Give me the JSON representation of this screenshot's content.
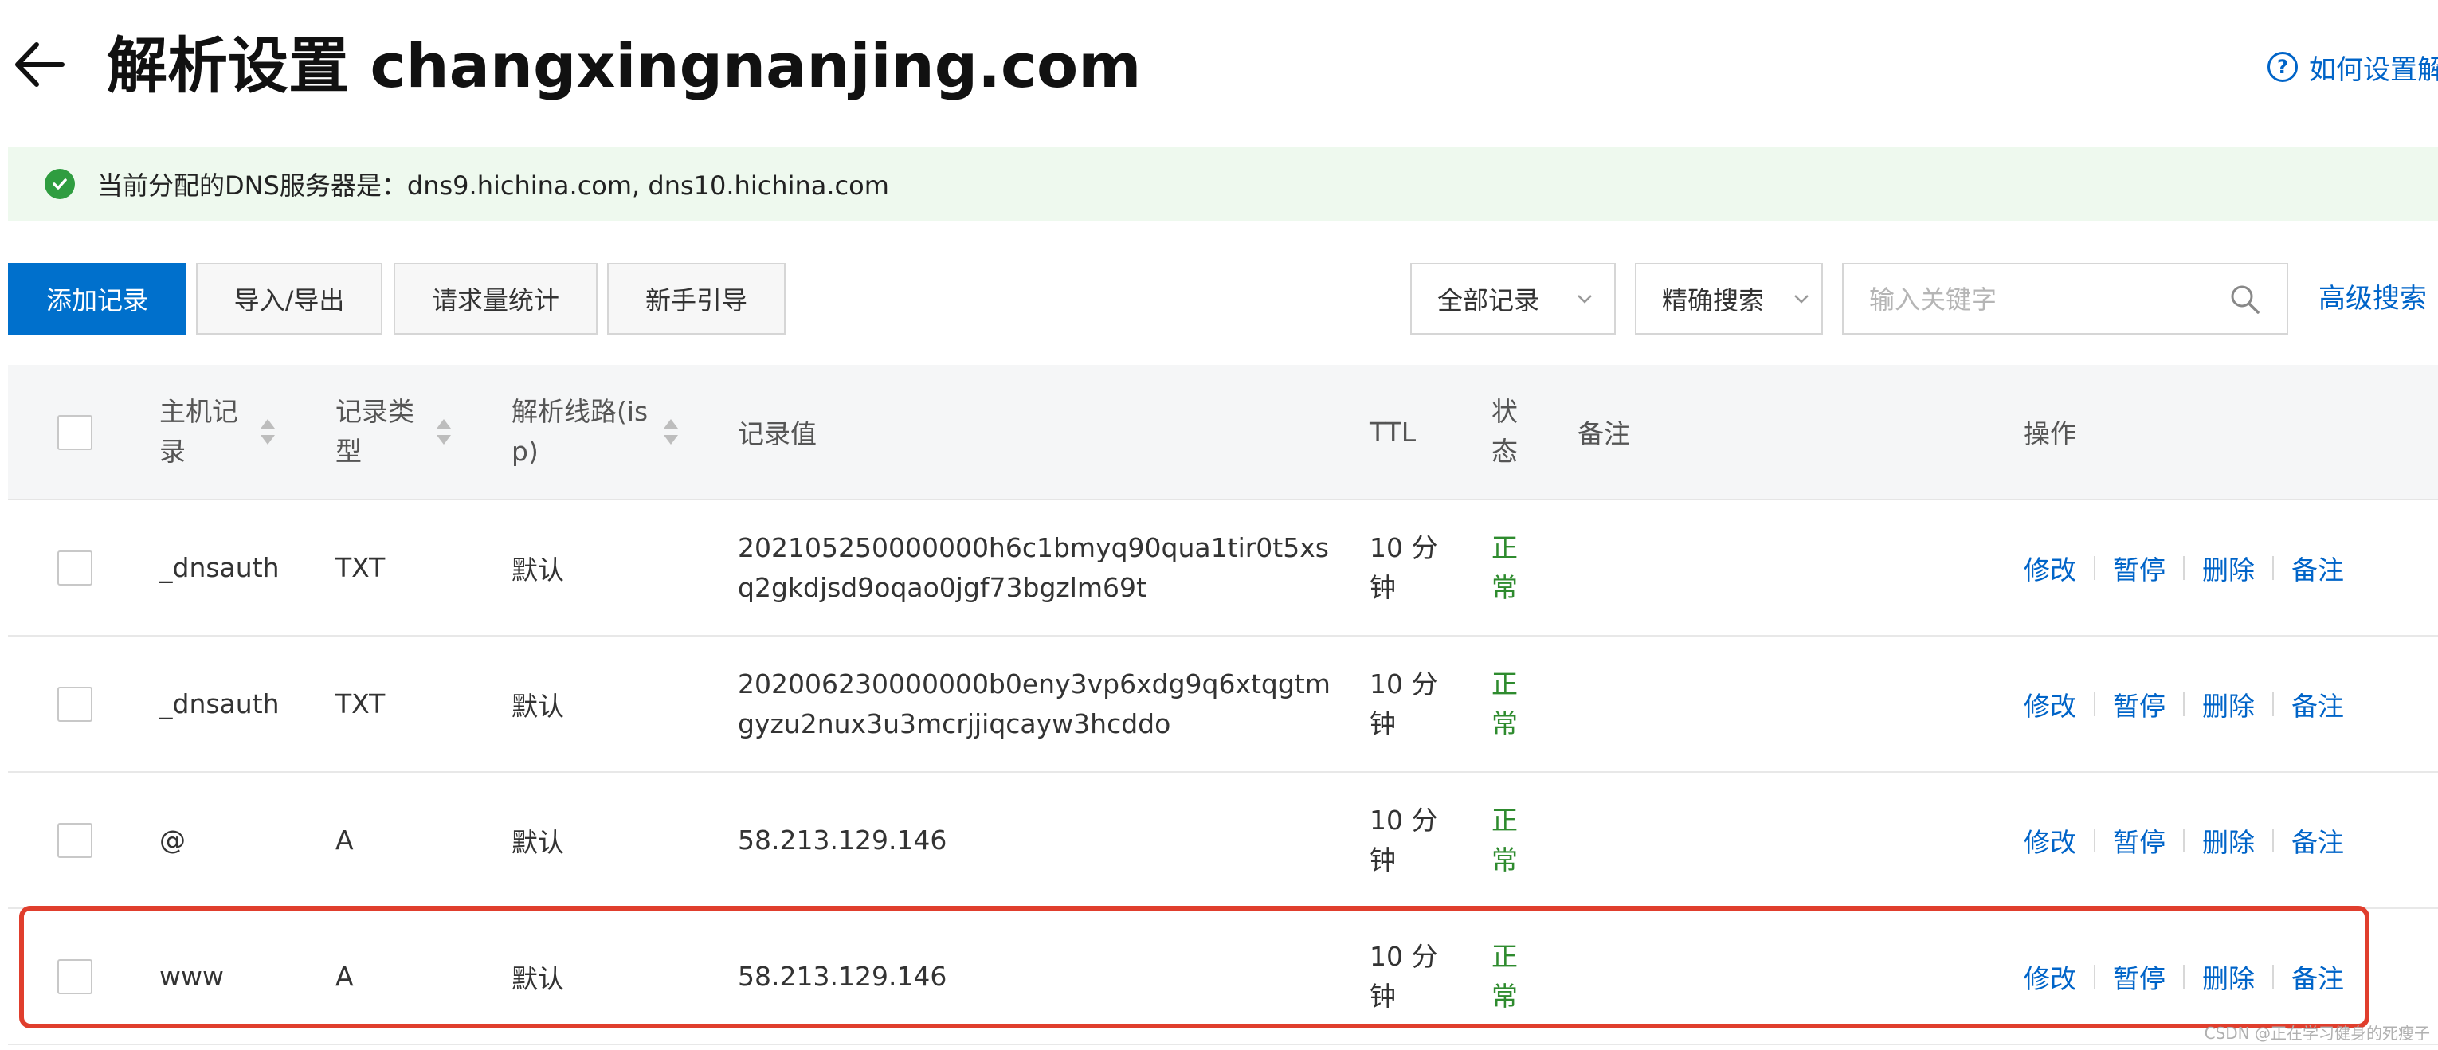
{
  "header": {
    "title": "解析设置 changxingnanjing.com",
    "help_link": "如何设置解"
  },
  "notice": {
    "text": "当前分配的DNS服务器是：dns9.hichina.com, dns10.hichina.com"
  },
  "toolbar": {
    "add_record": "添加记录",
    "import_export": "导入/导出",
    "request_stats": "请求量统计",
    "beginner_guide": "新手引导",
    "record_filter": "全部记录",
    "search_mode": "精确搜索",
    "search_placeholder": "输入关键字",
    "advanced_search": "高级搜索"
  },
  "table": {
    "headers": {
      "host": [
        "主机记",
        "录"
      ],
      "type": [
        "记录类",
        "型"
      ],
      "line": [
        "解析线路(is",
        "p)"
      ],
      "value": "记录值",
      "ttl": "TTL",
      "status": [
        "状",
        "态"
      ],
      "remark": "备注",
      "actions": "操作"
    },
    "action_labels": [
      "修改",
      "暂停",
      "删除",
      "备注"
    ],
    "rows": [
      {
        "host": "_dnsauth",
        "type": "TXT",
        "line": "默认",
        "value": [
          "202105250000000h6c1bmyq90qua1tir0t5xs",
          "q2gkdjsd9oqao0jgf73bgzlm69t"
        ],
        "ttl": [
          "10 分",
          "钟"
        ],
        "status": [
          "正",
          "常"
        ]
      },
      {
        "host": "_dnsauth",
        "type": "TXT",
        "line": "默认",
        "value": [
          "202006230000000b0eny3vp6xdg9q6xtqgtm",
          "gyzu2nux3u3mcrjjiqcayw3hcddo"
        ],
        "ttl": [
          "10 分",
          "钟"
        ],
        "status": [
          "正",
          "常"
        ]
      },
      {
        "host": "@",
        "type": "A",
        "line": "默认",
        "value": [
          "58.213.129.146"
        ],
        "ttl": [
          "10 分",
          "钟"
        ],
        "status": [
          "正",
          "常"
        ]
      },
      {
        "host": "www",
        "type": "A",
        "line": "默认",
        "value": [
          "58.213.129.146"
        ],
        "ttl": [
          "10 分",
          "钟"
        ],
        "status": [
          "正",
          "常"
        ]
      }
    ]
  },
  "watermark": "CSDN @正在学习健身的死瘦子",
  "colors": {
    "primary": "#0070cc",
    "link": "#0064c8",
    "status_ok": "#2e8b2e",
    "notice_bg": "#eef9ee",
    "highlight": "#e03e2d"
  },
  "icons": [
    "back-arrow-icon",
    "help-icon",
    "check-circle-icon",
    "chevron-down-icon",
    "search-icon",
    "sort-icon"
  ]
}
